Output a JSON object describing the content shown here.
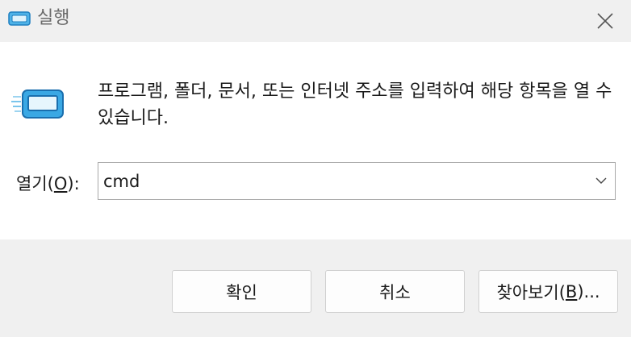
{
  "window": {
    "title": "실행",
    "close_icon": "close-icon"
  },
  "description": "프로그램, 폴더, 문서, 또는 인터넷 주소를 입력하여 해당 항목을 열 수 있습니다.",
  "open_field": {
    "label_prefix": "열기(",
    "label_mnemonic": "O",
    "label_suffix": "):",
    "value": "cmd"
  },
  "buttons": {
    "ok": "확인",
    "cancel": "취소",
    "browse_prefix": "찾아보기(",
    "browse_mnemonic": "B",
    "browse_suffix": ")..."
  },
  "colors": {
    "titlebar_bg": "#f0f0f0",
    "footer_bg": "#f0f0f0",
    "icon_blue": "#2d9bd8"
  }
}
